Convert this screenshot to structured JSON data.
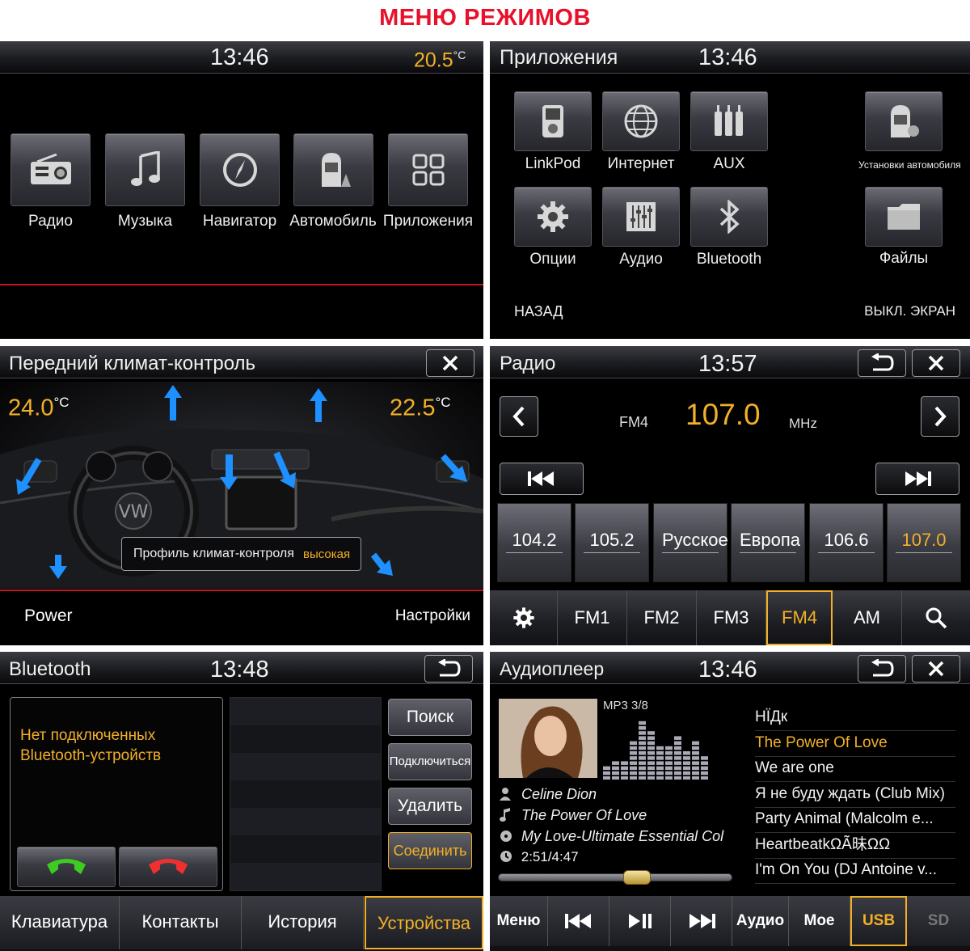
{
  "header": {
    "title": "МЕНЮ РЕЖИМОВ"
  },
  "main_menu": {
    "clock": "13:46",
    "temp": "20.5",
    "temp_unit": "°C",
    "items": [
      "Радио",
      "Музыка",
      "Навигатор",
      "Автомобиль",
      "Приложения"
    ]
  },
  "apps": {
    "title": "Приложения",
    "clock": "13:46",
    "items": [
      "LinkPod",
      "Интернет",
      "AUX",
      "Установки автомобиля",
      "Опции",
      "Аудио",
      "Bluetooth",
      "Файлы"
    ],
    "back": "НАЗАД",
    "screen_off": "ВЫКЛ. ЭКРАН"
  },
  "climate": {
    "title": "Передний климат-контроль",
    "left_temp": "24.0",
    "right_temp": "22.5",
    "unit": "°C",
    "profile_label": "Профиль климат-контроля",
    "profile_value": "высокая",
    "power": "Power",
    "settings": "Настройки"
  },
  "radio": {
    "title": "Радио",
    "clock": "13:57",
    "band": "FM4",
    "frequency": "107.0",
    "unit": "MHz",
    "presets": [
      "104.2",
      "105.2",
      "Русское",
      "Европа",
      "106.6",
      "107.0"
    ],
    "bands": [
      "FM1",
      "FM2",
      "FM3",
      "FM4",
      "AM"
    ],
    "active_band": "FM4",
    "accent": "#f2b027"
  },
  "bluetooth": {
    "title": "Bluetooth",
    "clock": "13:48",
    "message_line1": "Нет подключенных",
    "message_line2": "Bluetooth-устройств",
    "buttons": [
      "Поиск",
      "Подключиться",
      "Удалить",
      "Соединить"
    ],
    "tabs": [
      "Клавиатура",
      "Контакты",
      "История",
      "Устройства"
    ],
    "active_tab": "Устройства"
  },
  "audioplayer": {
    "title": "Аудиоплеер",
    "clock": "13:46",
    "format": "MP3 3/8",
    "artist": "Celine Dion",
    "song": "The Power Of Love",
    "album": "My Love-Ultimate Essential Col",
    "time": "2:51/4:47",
    "progress": 0.59,
    "tracks": [
      "НЇДк",
      "The Power Of Love",
      "We are one",
      "Я не буду ждать (Club Mix)",
      "Party Animal (Malcolm e...",
      "HeartbeatkΩÃ昧ΩΩ",
      "I'm On You (DJ Antoine v..."
    ],
    "active_track": 1,
    "bar": [
      "Меню",
      "Аудио",
      "Мое",
      "USB",
      "SD"
    ],
    "active_source": "USB"
  }
}
